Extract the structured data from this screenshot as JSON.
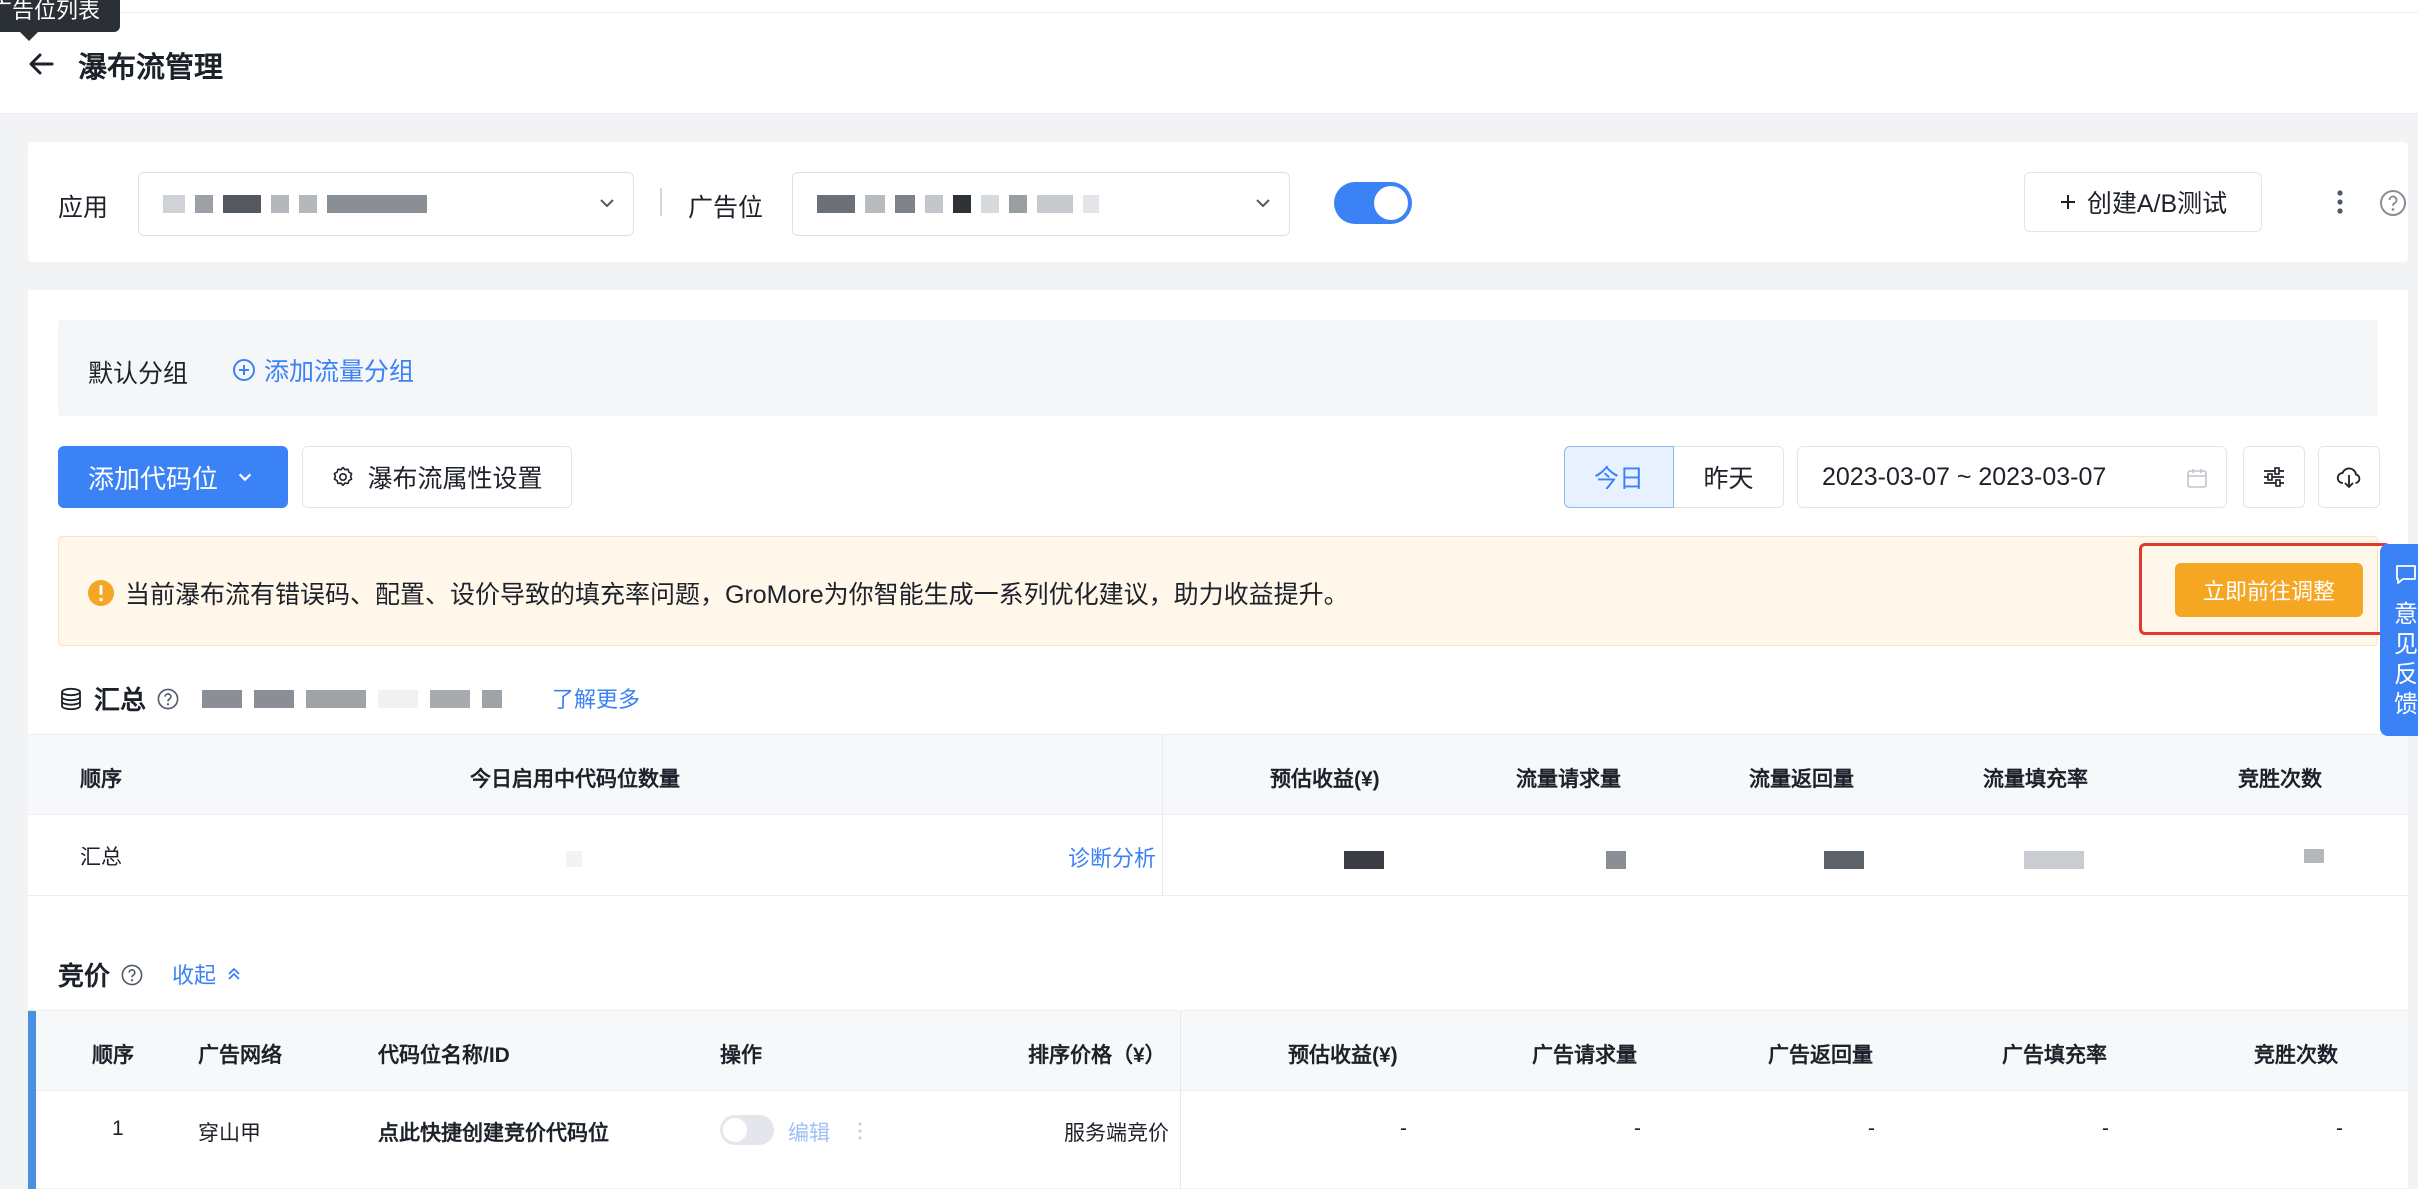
{
  "header": {
    "tooltip": "广告位列表",
    "title": "瀑布流管理"
  },
  "filters": {
    "app_label": "应用",
    "adslot_label": "广告位",
    "create_ab": "创建A/B测试"
  },
  "group": {
    "default": "默认分组",
    "add": "添加流量分组"
  },
  "toolbar": {
    "add_code": "添加代码位",
    "waterfall_settings": "瀑布流属性设置",
    "today": "今日",
    "yesterday": "昨天",
    "date_range": "2023-03-07 ~ 2023-03-07"
  },
  "alert": {
    "text": "当前瀑布流有错误码、配置、设价导致的填充率问题，GroMore为你智能生成一系列优化建议，助力收益提升。",
    "button": "立即前往调整"
  },
  "summary": {
    "title": "汇总",
    "learn_more": "了解更多",
    "columns": [
      "顺序",
      "今日启用中代码位数量",
      "预估收益(¥)",
      "流量请求量",
      "流量返回量",
      "流量填充率",
      "竞胜次数"
    ],
    "row_label": "汇总",
    "diagnose": "诊断分析"
  },
  "bidding": {
    "title": "竞价",
    "collapse": "收起",
    "columns": [
      "顺序",
      "广告网络",
      "代码位名称/ID",
      "操作",
      "排序价格（¥）",
      "预估收益(¥)",
      "广告请求量",
      "广告返回量",
      "广告填充率",
      "竞胜次数"
    ],
    "row": {
      "order": "1",
      "network": "穿山甲",
      "name_link": "点此快捷创建竞价代码位",
      "edit": "编辑",
      "price": "服务端竞价",
      "revenue": "-",
      "requests": "-",
      "returns": "-",
      "fill_rate": "-",
      "wins": "-"
    }
  },
  "feedback": "意见反馈",
  "colors": {
    "primary": "#3b82f6",
    "warning": "#f5a623",
    "highlight_frame": "#e03a2f"
  }
}
